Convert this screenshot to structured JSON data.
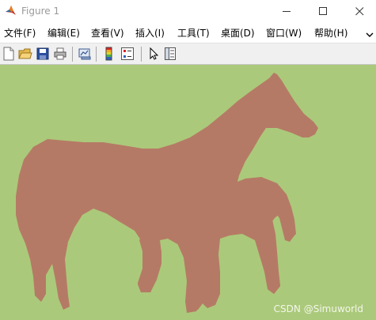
{
  "window": {
    "title": "Figure 1",
    "controls": {
      "minimize_icon": "minimize-icon",
      "maximize_icon": "maximize-icon",
      "close_icon": "close-icon"
    }
  },
  "menubar": {
    "items": [
      {
        "label": "文件(F)"
      },
      {
        "label": "编辑(E)"
      },
      {
        "label": "查看(V)"
      },
      {
        "label": "插入(I)"
      },
      {
        "label": "工具(T)"
      },
      {
        "label": "桌面(D)"
      },
      {
        "label": "窗口(W)"
      },
      {
        "label": "帮助(H)"
      }
    ],
    "overflow_icon": "chevron-overflow-icon"
  },
  "toolbar": {
    "buttons": [
      {
        "icon": "new-figure-icon"
      },
      {
        "icon": "open-file-icon"
      },
      {
        "icon": "save-icon"
      },
      {
        "icon": "print-icon"
      },
      {
        "icon": "link-plot-icon"
      },
      {
        "icon": "insert-colorbar-icon"
      },
      {
        "icon": "insert-legend-icon"
      },
      {
        "icon": "edit-plot-pointer-icon"
      },
      {
        "icon": "property-inspector-icon"
      }
    ]
  },
  "figure": {
    "background_color": "#abc97a",
    "shape_color": "#b57a66",
    "watermark": "CSDN @Simuworld"
  }
}
